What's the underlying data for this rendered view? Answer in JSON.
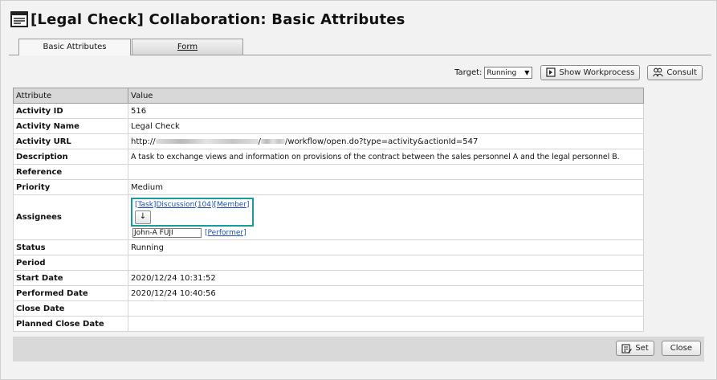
{
  "title": "[Legal Check] Collaboration: Basic Attributes",
  "tabs": [
    {
      "label": "Basic Attributes"
    },
    {
      "label": "Form"
    }
  ],
  "toolbar": {
    "target_label": "Target:",
    "target_value": "Running",
    "show_workprocess": "Show Workprocess",
    "consult": "Consult"
  },
  "table": {
    "headers": [
      "Attribute",
      "Value"
    ],
    "activity_id": {
      "label": "Activity ID",
      "value": "516"
    },
    "activity_name": {
      "label": "Activity Name",
      "value": "Legal Check"
    },
    "activity_url": {
      "label": "Activity URL",
      "prefix": "http://",
      "mid": "/",
      "suffix": "/workflow/open.do?type=activity&actionId=547"
    },
    "description": {
      "label": "Description",
      "value": "A task to exchange views and information on provisions of the contract between the sales personnel A and the legal personnel B."
    },
    "reference": {
      "label": "Reference",
      "value": ""
    },
    "priority": {
      "label": "Priority",
      "value": "Medium"
    },
    "assignees": {
      "label": "Assignees",
      "link": "[Task]Discussion(104)[Member]",
      "performer_name": "John-A FUJI",
      "performer_link": "[Performer]"
    },
    "status": {
      "label": "Status",
      "value": "Running"
    },
    "period": {
      "label": "Period",
      "value": ""
    },
    "start_date": {
      "label": "Start Date",
      "value": "2020/12/24 10:31:52"
    },
    "performed_date": {
      "label": "Performed Date",
      "value": "2020/12/24 10:40:56"
    },
    "close_date": {
      "label": "Close Date",
      "value": ""
    },
    "planned_close_date": {
      "label": "Planned Close Date",
      "value": ""
    }
  },
  "footer": {
    "set_label": "Set",
    "close_label": "Close"
  }
}
